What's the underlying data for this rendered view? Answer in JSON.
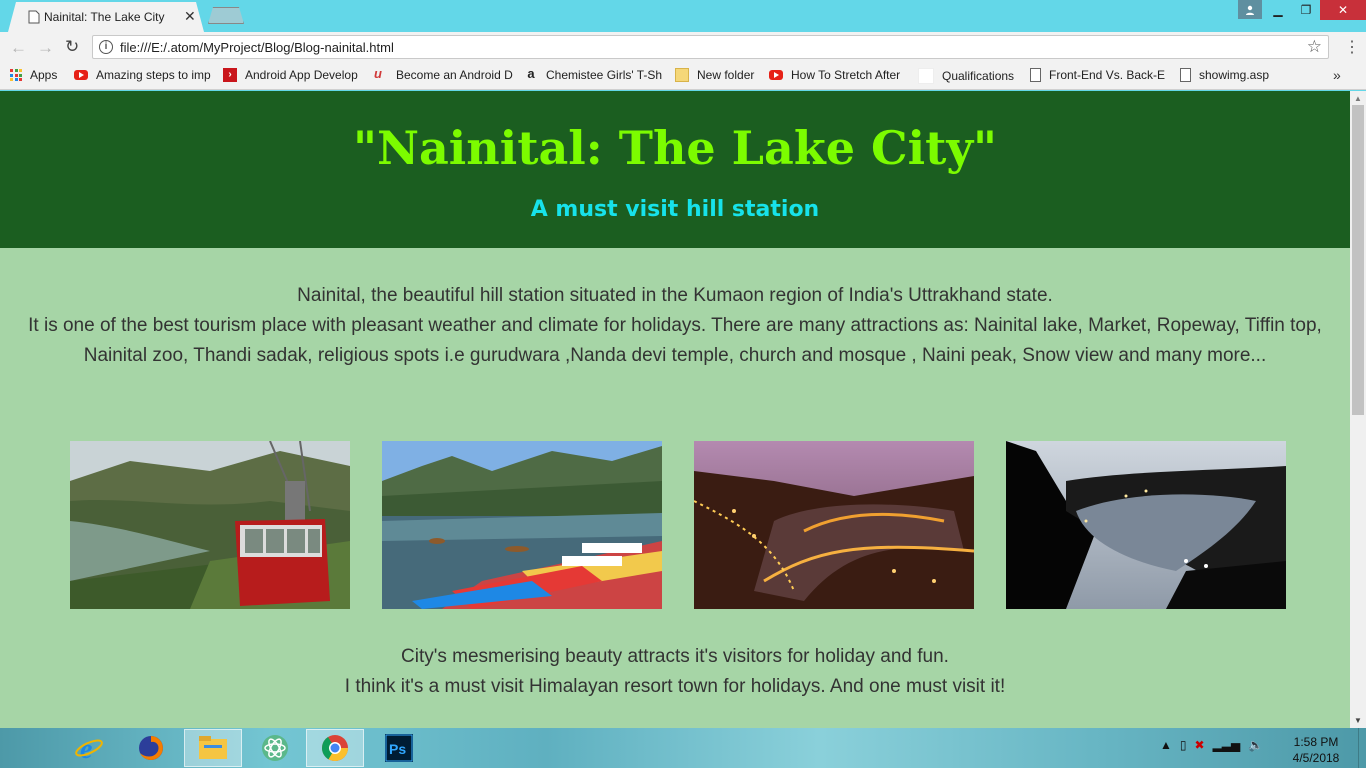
{
  "browser": {
    "tab_title": "Nainital: The Lake City",
    "url": "file:///E:/.atom/MyProject/Blog/Blog-nainital.html",
    "bookmarks": [
      {
        "label": "Apps",
        "icon": "apps-grid-icon"
      },
      {
        "label": "Amazing steps to imp",
        "icon": "youtube-icon"
      },
      {
        "label": "Android App Develop",
        "icon": "red-chevron-icon"
      },
      {
        "label": "Become an Android D",
        "icon": "udemy-icon"
      },
      {
        "label": "Chemistee Girls' T-Sh",
        "icon": "amazon-icon"
      },
      {
        "label": "New folder",
        "icon": "folder-icon"
      },
      {
        "label": "How To Stretch After",
        "icon": "youtube-icon"
      },
      {
        "label": "Qualifications",
        "icon": "blank-page-icon"
      },
      {
        "label": "Front-End Vs. Back-E",
        "icon": "page-icon"
      },
      {
        "label": "showimg.asp",
        "icon": "page-icon"
      }
    ],
    "more_bookmarks": "»"
  },
  "page": {
    "title": "\"Nainital: The Lake City\"",
    "subtitle": "A must visit hill station",
    "intro_line1": "Nainital, the beautiful hill station situated in the Kumaon region of India's Uttrakhand state.",
    "intro_line2": "It is one of the best tourism place with pleasant weather and climate for holidays. There are many attractions as: Nainital lake, Market, Ropeway, Tiffin top, Nainital zoo, Thandi sadak, religious spots i.e gurudwara ,Nanda devi temple, church and mosque , Naini peak, Snow view and many more...",
    "photos": [
      {
        "subject": "ropeway cable car over lake"
      },
      {
        "subject": "boats on Naini lake"
      },
      {
        "subject": "Nainital at night - orange lights"
      },
      {
        "subject": "Nainital at night - lake view"
      }
    ],
    "outro_line1": "City's mesmerising beauty attracts it's visitors for holiday and fun.",
    "outro_line2": "I think it's a must visit Himalayan resort town for holidays. And one must visit it!"
  },
  "taskbar": {
    "apps": [
      "internet-explorer-icon",
      "firefox-icon",
      "file-explorer-icon",
      "atom-icon",
      "chrome-icon",
      "photoshop-icon"
    ],
    "time": "1:58 PM",
    "date": "4/5/2018"
  },
  "colors": {
    "header_bg": "#1b5e20",
    "title": "#7cfc00",
    "subtitle": "#17e2ea",
    "page_bg": "#a6d5a6"
  }
}
